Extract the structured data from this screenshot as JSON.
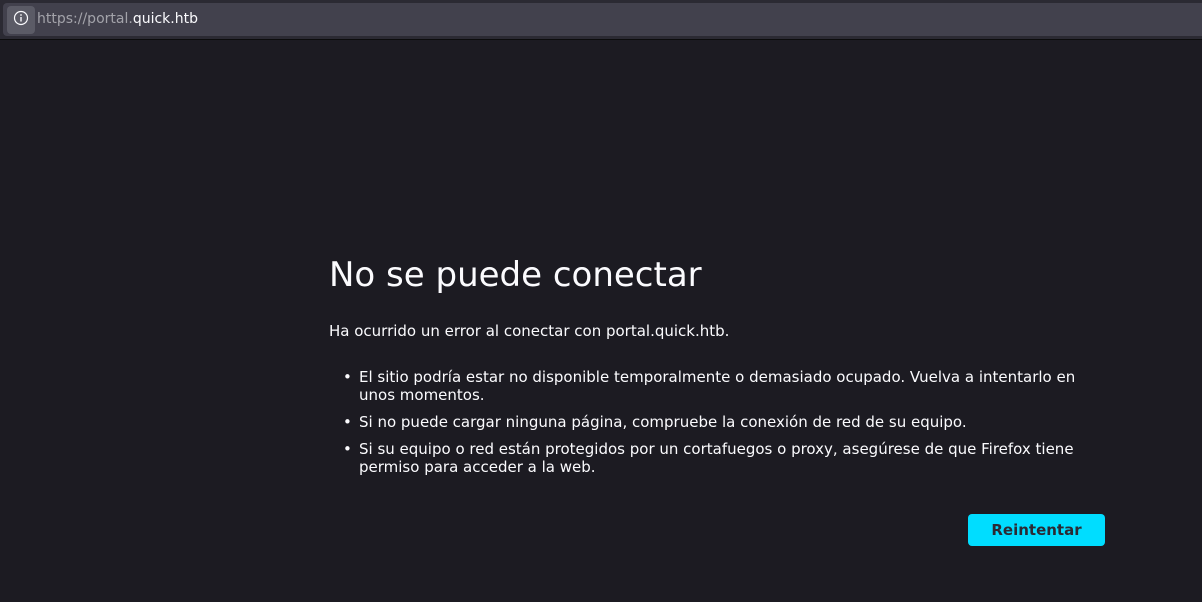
{
  "urlbar": {
    "url_prefix": "https://portal.",
    "url_host": "quick.htb",
    "identity_icon": "info-icon"
  },
  "error": {
    "title": "No se puede conectar",
    "description": "Ha ocurrido un error al conectar con portal.quick.htb.",
    "tips": [
      "El sitio podría estar no disponible temporalmente o demasiado ocupado. Vuelva a intentarlo en unos momentos.",
      "Si no puede cargar ninguna página, compruebe la conexión de red de su equipo.",
      "Si su equipo o red están protegidos por un cortafuegos o proxy, asegúrese de que Firefox tiene permiso para acceder a la web."
    ],
    "retry_label": "Reintentar"
  },
  "colors": {
    "background": "#1c1b22",
    "toolbar": "#2b2a33",
    "urlbar": "#42414d",
    "accent": "#00ddff"
  }
}
